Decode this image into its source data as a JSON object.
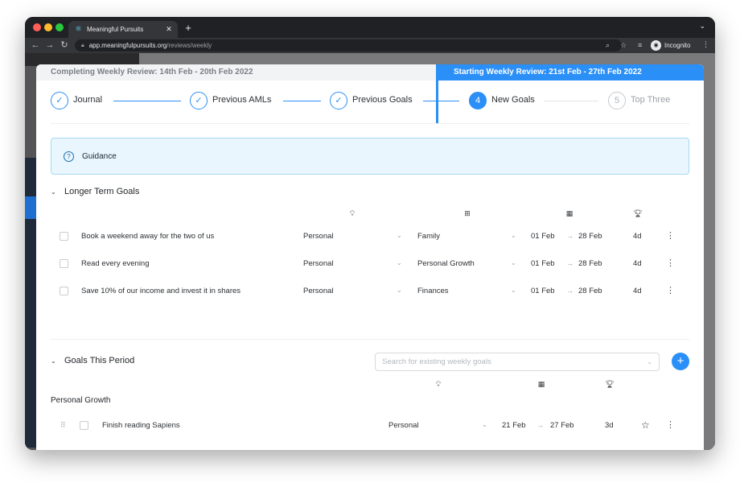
{
  "browser": {
    "tab_title": "Meaningful Pursuits",
    "tab_favicon": "react-atom-icon",
    "url_host": "app.meaningfulpursuits.org",
    "url_path": "/reviews/weekly",
    "incognito_label": "Incognito"
  },
  "review": {
    "completing": "Completing Weekly Review: 14th Feb - 20th Feb 2022",
    "starting": "Starting Weekly Review: 21st Feb - 27th Feb 2022",
    "accent_color": "#2a8ff7"
  },
  "steps": [
    {
      "label": "Journal",
      "state": "done",
      "marker": "✓"
    },
    {
      "label": "Previous AMLs",
      "state": "done",
      "marker": "✓"
    },
    {
      "label": "Previous Goals",
      "state": "done",
      "marker": "✓"
    },
    {
      "label": "New Goals",
      "state": "active",
      "marker": "4"
    },
    {
      "label": "Top Three",
      "state": "todo",
      "marker": "5"
    }
  ],
  "guidance": {
    "label": "Guidance"
  },
  "longer_term": {
    "title": "Longer Term Goals",
    "columns": {
      "type_icon": "lightbulb-icon",
      "area_icon": "grid-icon",
      "dates_icon": "calendar-icon",
      "duration_icon": "trophy-icon"
    },
    "rows": [
      {
        "title": "Book a weekend away for the two of us",
        "type": "Personal",
        "area": "Family",
        "start": "01 Feb",
        "end": "28 Feb",
        "duration": "4d"
      },
      {
        "title": "Read every evening",
        "type": "Personal",
        "area": "Personal Growth",
        "start": "01 Feb",
        "end": "28 Feb",
        "duration": "4d"
      },
      {
        "title": "Save 10% of our income and invest it in shares",
        "type": "Personal",
        "area": "Finances",
        "start": "01 Feb",
        "end": "28 Feb",
        "duration": "4d"
      }
    ]
  },
  "this_period": {
    "title": "Goals This Period",
    "search_placeholder": "Search for existing weekly goals",
    "add_label": "+",
    "group_label": "Personal Growth",
    "rows": [
      {
        "title": "Finish reading Sapiens",
        "type": "Personal",
        "start": "21 Feb",
        "end": "27 Feb",
        "duration": "3d"
      }
    ]
  }
}
